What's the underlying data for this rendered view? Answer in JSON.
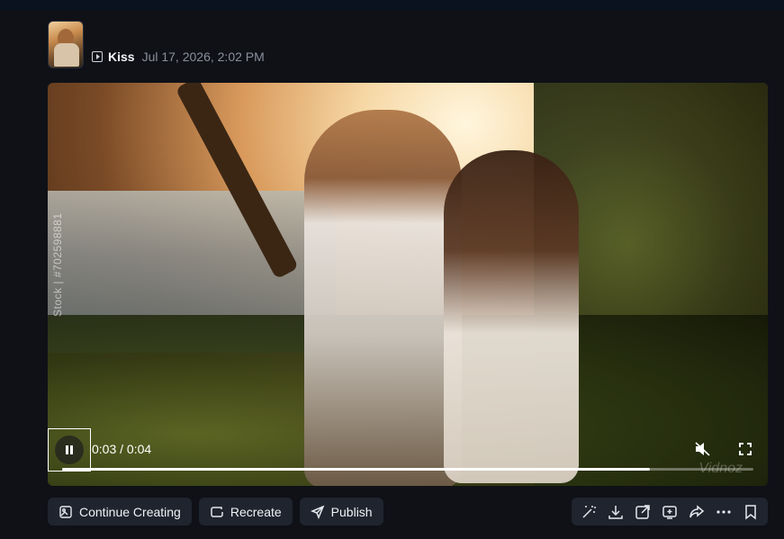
{
  "header": {
    "title": "Kiss",
    "date": "Jul 17, 2026, 2:02 PM",
    "type_icon": "video-icon"
  },
  "player": {
    "watermark_side": "Stock | #702598881",
    "watermark_corner": "Vidnoz",
    "time_display": "0:03 / 0:04",
    "progress": 0.85,
    "muted": true,
    "playing": true
  },
  "actions": {
    "continue_label": "Continue Creating",
    "recreate_label": "Recreate",
    "publish_label": "Publish"
  },
  "toolbar": {
    "icons": [
      "magic-wand-icon",
      "download-icon",
      "export-icon",
      "caption-icon",
      "share-icon",
      "more-icon",
      "bookmark-icon"
    ]
  },
  "colors": {
    "background": "#0f1117",
    "button_bg": "#1f242e",
    "text": "#f0f2f6",
    "muted_text": "#8a8f9a"
  }
}
